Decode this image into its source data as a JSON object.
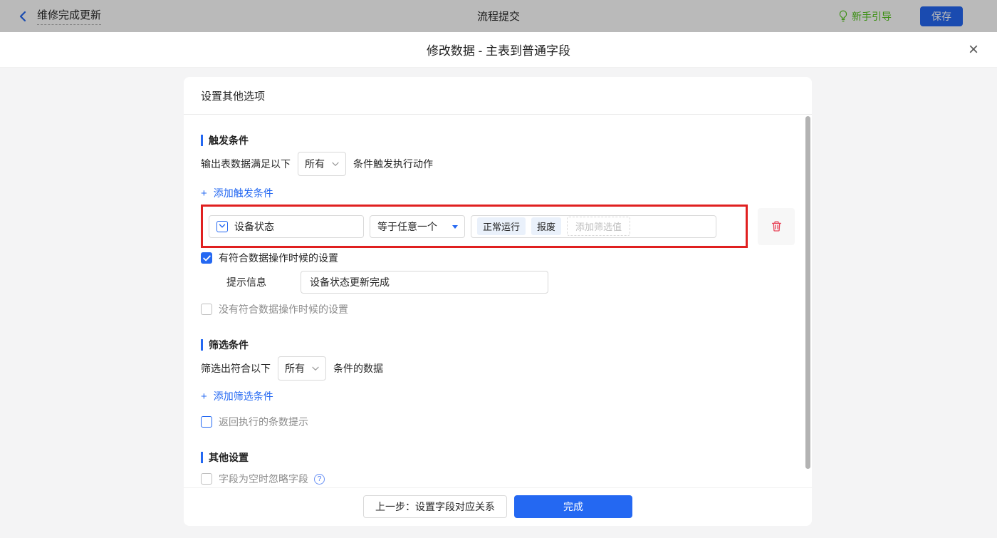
{
  "icons": {
    "plus": "+",
    "close": "×",
    "help": "?"
  },
  "colors": {
    "accent": "#2468f2",
    "highlight_red": "#e02020",
    "danger_red": "#e8465a",
    "guide_green": "#52c41a"
  },
  "topbar": {
    "back_label": "维修完成更新",
    "center_title": "流程提交",
    "guide_label": "新手引导",
    "save_label": "保存"
  },
  "dialog": {
    "title": "修改数据 - 主表到普通字段"
  },
  "panel": {
    "title": "设置其他选项",
    "trigger": {
      "title": "触发条件",
      "prefix": "输出表数据满足以下",
      "match_value": "所有",
      "suffix": "条件触发执行动作",
      "add_label": "添加触发条件",
      "condition": {
        "field": "设备状态",
        "operator": "等于任意一个",
        "values": [
          "正常运行",
          "报废"
        ],
        "add_value_label": "添加筛选值"
      },
      "matched_label": "有符合数据操作时候的设置",
      "tip_label": "提示信息",
      "tip_value": "设备状态更新完成",
      "unmatched_label": "没有符合数据操作时候的设置"
    },
    "filter": {
      "title": "筛选条件",
      "prefix": "筛选出符合以下",
      "match_value": "所有",
      "suffix": "条件的数据",
      "add_label": "添加筛选条件",
      "count_label": "返回执行的条数提示"
    },
    "other": {
      "title": "其他设置",
      "ignore_label": "字段为空时忽略字段"
    },
    "footer": {
      "prev_label": "上一步：设置字段对应关系",
      "done_label": "完成"
    }
  }
}
